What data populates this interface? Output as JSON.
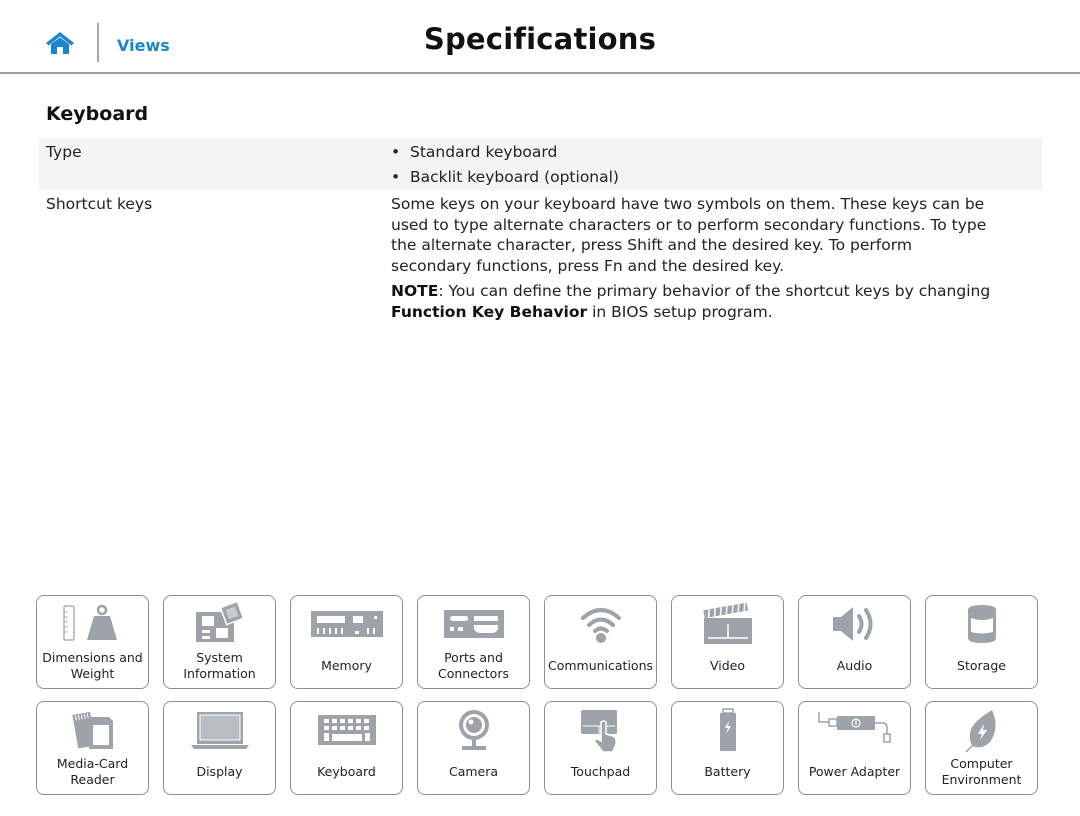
{
  "header": {
    "home_icon": "home-icon",
    "views_label": "Views",
    "title": "Specifications",
    "accent_color": "#1d86c9"
  },
  "section": {
    "title": "Keyboard"
  },
  "spec_rows": [
    {
      "label": "Type",
      "bullets": [
        "Standard keyboard",
        "Backlit keyboard (optional)"
      ]
    },
    {
      "label": "Shortcut keys",
      "paragraph": "Some keys on your keyboard have two symbols on them. These keys can be used to type alternate characters or to perform secondary functions. To type the alternate character, press Shift and the desired key. To perform secondary functions, press Fn and the desired key.",
      "note_label": "NOTE",
      "note_text_1": ": You can define the primary behavior of the shortcut keys by changing ",
      "note_bold": "Function Key Behavior",
      "note_text_2": " in BIOS setup program."
    }
  ],
  "nav_tiles": [
    {
      "label": "Dimensions and Weight",
      "icon": "scale-weight-icon"
    },
    {
      "label": "System Information",
      "icon": "motherboard-icon"
    },
    {
      "label": "Memory",
      "icon": "memory-module-icon"
    },
    {
      "label": "Ports and Connectors",
      "icon": "ports-icon"
    },
    {
      "label": "Communications",
      "icon": "wifi-icon"
    },
    {
      "label": "Video",
      "icon": "clapperboard-icon"
    },
    {
      "label": "Audio",
      "icon": "speaker-icon"
    },
    {
      "label": "Storage",
      "icon": "storage-drive-icon"
    },
    {
      "label": "Media-Card Reader",
      "icon": "memory-card-icon"
    },
    {
      "label": "Display",
      "icon": "laptop-display-icon"
    },
    {
      "label": "Keyboard",
      "icon": "keyboard-icon"
    },
    {
      "label": "Camera",
      "icon": "webcam-icon"
    },
    {
      "label": "Touchpad",
      "icon": "touchpad-icon"
    },
    {
      "label": "Battery",
      "icon": "battery-icon"
    },
    {
      "label": "Power Adapter",
      "icon": "power-adapter-icon"
    },
    {
      "label": "Computer Environment",
      "icon": "leaf-icon"
    }
  ]
}
